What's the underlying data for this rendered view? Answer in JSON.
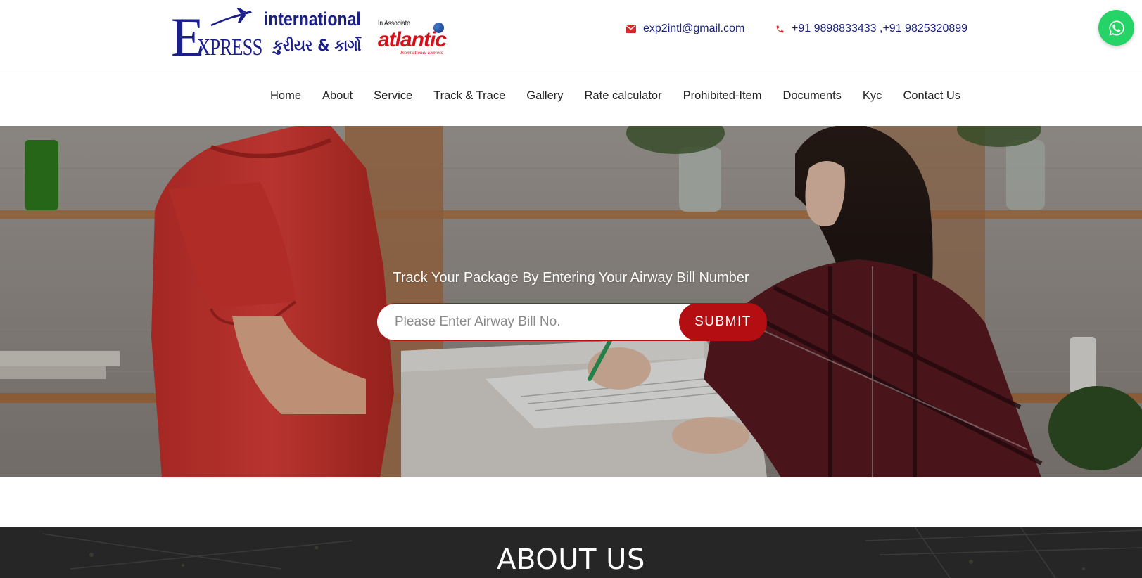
{
  "brand": {
    "logo_letter": "E",
    "logo_xpress": "XPRESS",
    "logo_international": "international",
    "logo_gujarati": "કુરીયર & કાર્ગો",
    "associate_label": "In Associate",
    "associate_name": "atlantic",
    "associate_sub": "International Express"
  },
  "contact": {
    "email": "exp2intl@gmail.com",
    "phone": "+91 9898833433 ,+91 9825320899"
  },
  "nav": {
    "items": [
      "Home",
      "About",
      "Service",
      "Track & Trace",
      "Gallery",
      "Rate calculator",
      "Prohibited-Item",
      "Documents",
      "Kyc",
      "Contact Us"
    ]
  },
  "hero": {
    "title": "Track Your Package By Entering Your Airway Bill Number",
    "input_placeholder": "Please Enter Airway Bill No.",
    "input_value": "",
    "submit_label": "SUBMIT"
  },
  "about": {
    "heading": "ABOUT US"
  },
  "colors": {
    "brand_blue": "#1a1f8c",
    "brand_red": "#b40d12",
    "whatsapp_green": "#25d366",
    "contact_text": "#1a237e"
  },
  "icons": {
    "email": "envelope-icon",
    "phone": "phone-icon",
    "whatsapp": "whatsapp-icon",
    "logo_plane": "airplane-icon"
  }
}
